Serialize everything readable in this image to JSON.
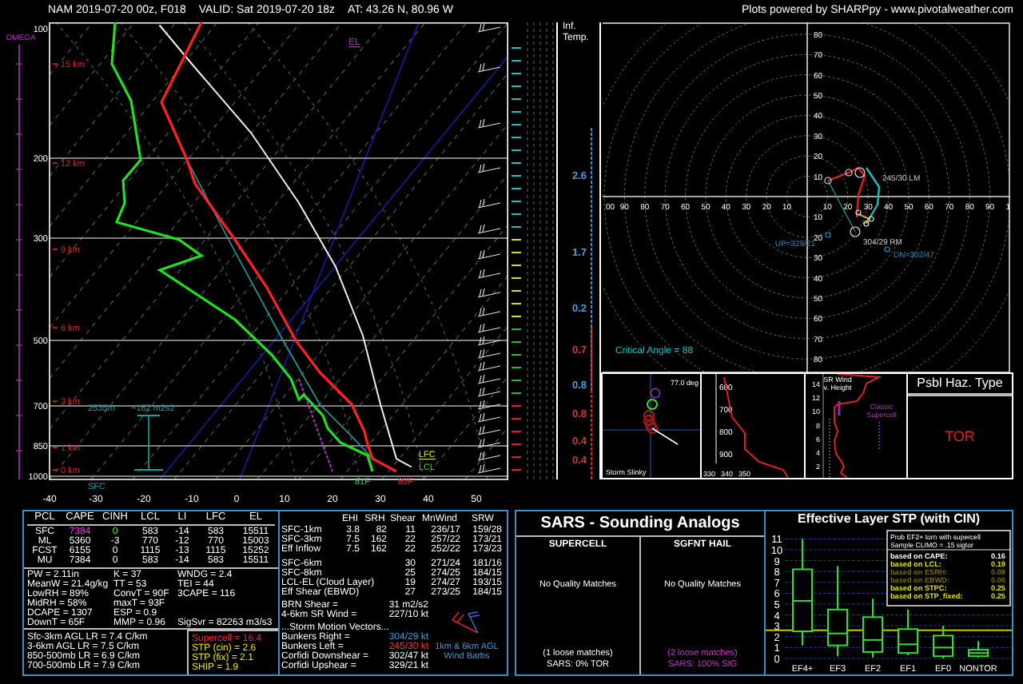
{
  "header": {
    "run": "NAM 2019-07-20 00z, F018",
    "valid": "VALID: Sat 2019-07-20 18z",
    "location": "AT: 43.26 N, 80.96 W",
    "credit": "Plots powered by SHARPpy - www.pivotalweather.com"
  },
  "skewt": {
    "omega_label": "OMEGA",
    "pressure_labels": [
      "100",
      "200",
      "300",
      "500",
      "700",
      "850",
      "1000"
    ],
    "height_labels": [
      "15 km",
      "12 km",
      "9 km",
      "6 km",
      "3 km",
      "1 km",
      "0 km"
    ],
    "temperature_labels": [
      "-40",
      "-30",
      "-20",
      "-10",
      "0",
      "10",
      "20",
      "30",
      "40",
      "50"
    ],
    "el_label": "EL",
    "lfc_label": "LFC",
    "lcl_label": "LCL",
    "sfc_label": "SFC",
    "inflow_top_label": "2535m",
    "srh_label": "~162 m2s2",
    "dewpoint_label": "81F",
    "temperature_label": "89F"
  },
  "inflow_column": {
    "title": "Inf. Temp.",
    "readings": [
      {
        "text": "2.6",
        "color": "#4a9fd8"
      },
      {
        "text": "1.7",
        "color": "#4a9fd8"
      },
      {
        "text": "0.2",
        "color": "#4a9fd8"
      },
      {
        "text": "0.7",
        "color": "#e03030"
      },
      {
        "text": "0.8",
        "color": "#4a9fd8"
      },
      {
        "text": "0.8",
        "color": "#e03030"
      },
      {
        "text": "0.4",
        "color": "#e03030"
      },
      {
        "text": "0.4",
        "color": "#e03030"
      }
    ]
  },
  "hodograph": {
    "top_labels": [
      "80",
      "70",
      "60",
      "50",
      "40",
      "30",
      "20",
      "10"
    ],
    "left_labels": [
      "00",
      "90",
      "80",
      "70",
      "60",
      "50",
      "40",
      "30",
      "20",
      "10"
    ],
    "right_labels": [
      "10",
      "20",
      "30",
      "40",
      "50",
      "60",
      "70",
      "80",
      "90",
      "1"
    ],
    "bottom_labels": [
      "10",
      "20",
      "30",
      "40",
      "50",
      "60",
      "70",
      "80"
    ],
    "left_mover": "245/30 LM",
    "right_mover": "304/29 RM",
    "upshear": "UP=329/21",
    "downshear": "DN=302/47",
    "critical_angle": "Critical Angle = 88"
  },
  "storm_slinky": {
    "angle": "77.0 deg",
    "title": "Storm Slinky"
  },
  "theta_e": {
    "pressure_labels": [
      "600",
      "700",
      "800",
      "900"
    ],
    "x_labels": [
      "330",
      "340",
      "350"
    ]
  },
  "sr_wind": {
    "title": "SR Wind v. Height",
    "height_labels": [
      "14",
      "12",
      "10",
      "8",
      "6",
      "4",
      "2"
    ],
    "classification": "Classic Supercell"
  },
  "hazard": {
    "title": "Psbl Haz. Type",
    "type": "TOR"
  },
  "parcels": {
    "columns": [
      "PCL",
      "CAPE",
      "CINH",
      "LCL",
      "LI",
      "LFC",
      "EL"
    ],
    "rows": [
      {
        "cells": [
          "SFC",
          "7384",
          "0",
          "583",
          "-14",
          "583",
          "15511"
        ],
        "highlight": true
      },
      {
        "cells": [
          "ML",
          "5360",
          "-3",
          "770",
          "-12",
          "770",
          "15003"
        ],
        "highlight": false
      },
      {
        "cells": [
          "FCST",
          "6155",
          "0",
          "1115",
          "-13",
          "1115",
          "15252"
        ],
        "highlight": false
      },
      {
        "cells": [
          "MU",
          "7384",
          "0",
          "583",
          "-14",
          "583",
          "15511"
        ],
        "highlight": false
      }
    ]
  },
  "indices": [
    [
      "PW = 2.11in",
      "K = 37",
      "WNDG = 2.4"
    ],
    [
      "MeanW = 21.4g/kg",
      "TT = 53",
      "TEI = 44"
    ],
    [
      "LowRH = 89%",
      "ConvT = 90F",
      "3CAPE = 116"
    ],
    [
      "MidRH = 58%",
      "maxT = 93F"
    ],
    [
      "DCAPE = 1307",
      "ESP = 0.9"
    ],
    [
      "DownT = 65F",
      "MMP = 0.96",
      "SigSvr = 82263 m3/s3"
    ]
  ],
  "lapse_rates": [
    "Sfc-3km AGL LR = 7.4 C/km",
    "3-6km AGL LR = 7.5 C/km",
    "850-500mb LR = 6.9 C/km",
    "700-500mb LR = 7.9 C/km"
  ],
  "composites": [
    {
      "text": "Supercell = 16.4",
      "color": "#ff2020"
    },
    {
      "text": "STP (cin) = 2.6",
      "color": "#e8e800"
    },
    {
      "text": "STP (fix) = 2.1",
      "color": "#e8e800"
    },
    {
      "text": "SHIP = 1.9",
      "color": "#e8e800"
    }
  ],
  "kinematics": {
    "columns": [
      "EHI",
      "SRH",
      "Shear",
      "MnWind",
      "SRW"
    ],
    "rows": [
      {
        "name": "SFC-1km",
        "values": [
          "3.8",
          "82",
          "11",
          "236/17",
          "159/28"
        ]
      },
      {
        "name": "SFC-3km",
        "values": [
          "7.5",
          "162",
          "22",
          "257/22",
          "173/21"
        ]
      },
      {
        "name": "Eff Inflow",
        "values": [
          "7.5",
          "162",
          "22",
          "252/22",
          "173/23"
        ]
      }
    ],
    "layer_rows": [
      {
        "name": "SFC-6km",
        "values": [
          "30",
          "271/24",
          "181/16"
        ]
      },
      {
        "name": "SFC-8km",
        "values": [
          "25",
          "274/25",
          "184/15"
        ]
      },
      {
        "name": "LCL-EL (Cloud Layer)",
        "values": [
          "19",
          "274/27",
          "193/15"
        ]
      },
      {
        "name": "Eff Shear (EBWD)",
        "values": [
          "27",
          "273/25",
          "184/15"
        ]
      }
    ],
    "params": [
      {
        "label": "BRN Shear =",
        "value": "31 m2/s2"
      },
      {
        "label": "4-6km SR Wind =",
        "value": "227/10 kt"
      }
    ],
    "storm_motion_title": "...Storm Motion Vectors...",
    "storm_motions": [
      {
        "label": "Bunkers Right =",
        "value": "304/29 kt",
        "color": "#3a9ad9"
      },
      {
        "label": "Bunkers Left =",
        "value": "245/30 kt",
        "color": "#ff3030"
      },
      {
        "label": "Corfidi Downshear =",
        "value": "302/47 kt",
        "color": "#ffffff"
      },
      {
        "label": "Corfidi Upshear =",
        "value": "329/21 kt",
        "color": "#ffffff"
      }
    ],
    "barb_caption": "1km & 6km AGL Wind Barbs"
  },
  "sars": {
    "title": "SARS - Sounding Analogs",
    "columns": [
      {
        "heading": "SUPERCELL",
        "quality": "No Quality Matches",
        "loose": "(1 loose matches)",
        "result": "SARS: 0% TOR",
        "color": "#ffffff"
      },
      {
        "heading": "SGFNT HAIL",
        "quality": "No Quality Matches",
        "loose": "(2 loose matches)",
        "result": "SARS: 100% SIG",
        "color": "#cc33cc"
      }
    ]
  },
  "stp": {
    "title": "Effective Layer STP (with CIN)",
    "yticks": [
      "11",
      "10",
      "9",
      "8",
      "7",
      "6",
      "5",
      "4",
      "3",
      "2",
      "1",
      "0"
    ],
    "categories": [
      "EF4+",
      "EF3",
      "EF2",
      "EF1",
      "EF0",
      "NONTOR"
    ],
    "legend_title": [
      "Prob EF2+ torn with supercell",
      "Sample CLIMO = .15 sigtor"
    ],
    "legend_rows": [
      {
        "label": "based on CAPE:",
        "value": "0.16",
        "color": "#ffffff"
      },
      {
        "label": "based on LCL:",
        "value": "0.19",
        "color": "#e0e000"
      },
      {
        "label": "based on ESRH:",
        "value": "0.08",
        "color": "#7a6a00"
      },
      {
        "label": "based on EBWD:",
        "value": "0.06",
        "color": "#7a6a00"
      },
      {
        "label": "based on STPC:",
        "value": "0.25",
        "color": "#e0e000"
      },
      {
        "label": "based on STP_fixed:",
        "value": "0.25",
        "color": "#e0e000"
      }
    ]
  }
}
